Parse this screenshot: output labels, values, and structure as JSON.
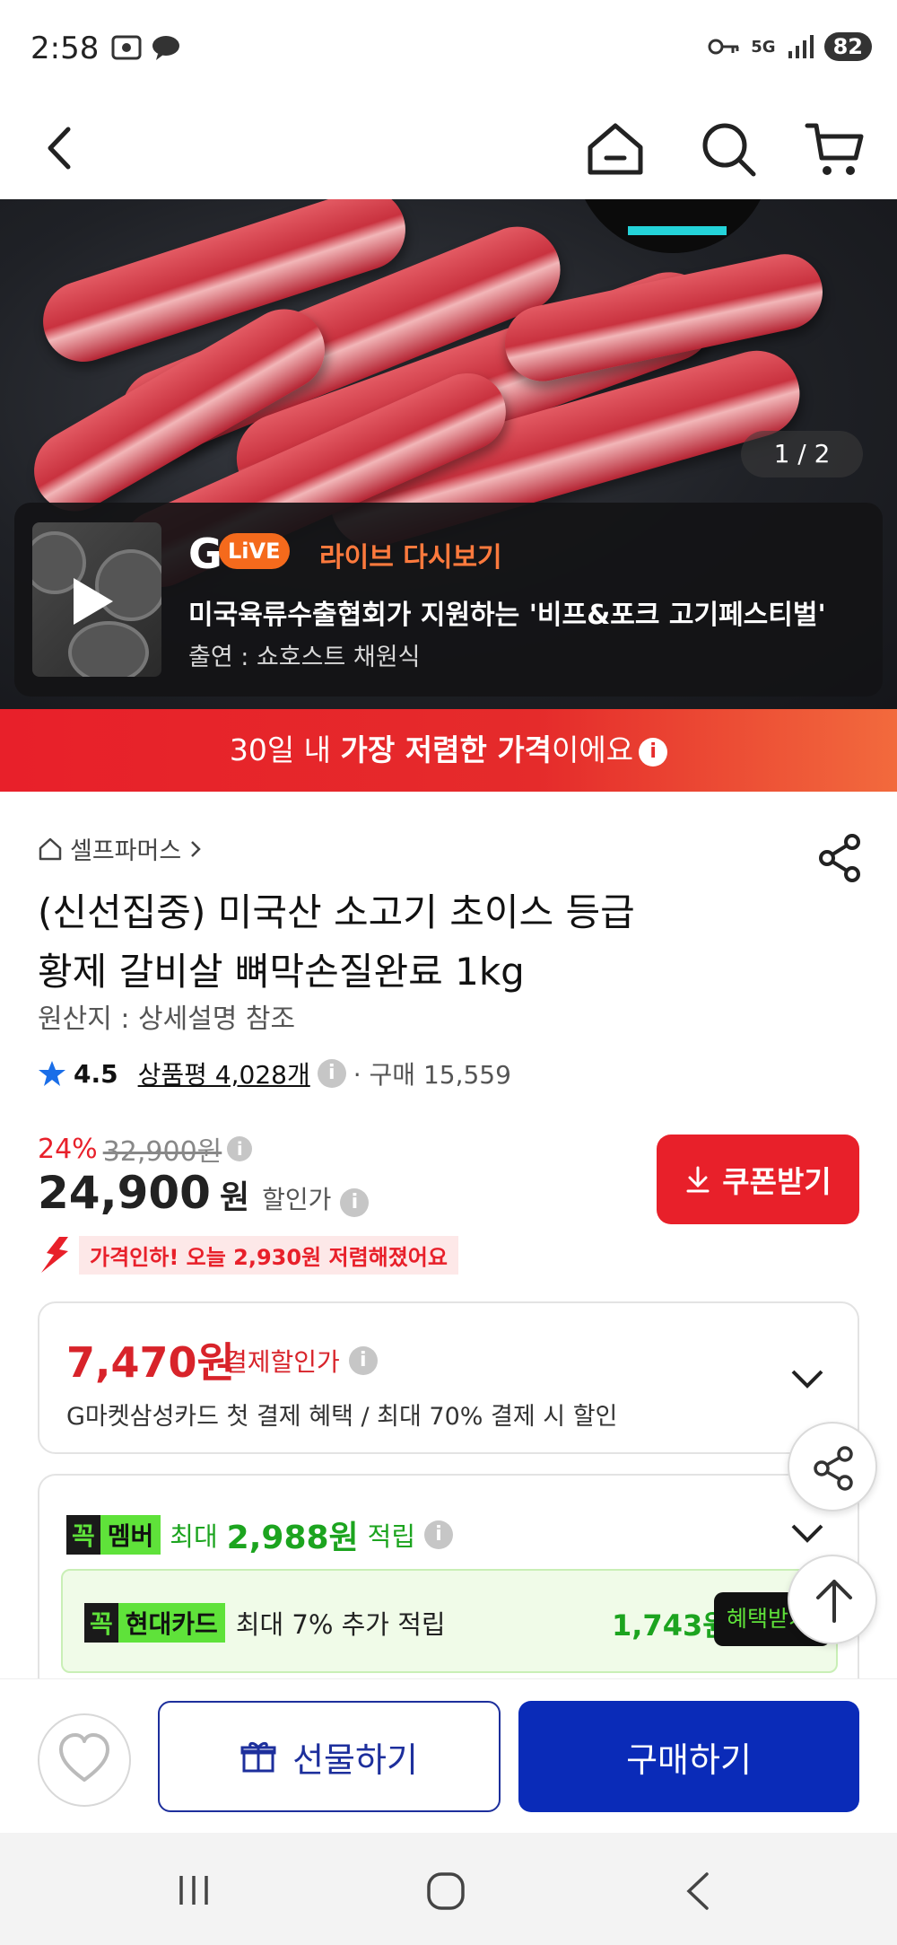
{
  "status_bar": {
    "time": "2:58",
    "network": "5G",
    "battery": "82"
  },
  "hero": {
    "image_counter": "1 / 2",
    "live": {
      "logo_g": "G",
      "logo_live": "LiVE",
      "label": "라이브 다시보기",
      "title": "미국육류수출협회가 지원하는 '비프&포크 고기페스티벌'",
      "host": "출연 : 쇼호스트 채원식"
    }
  },
  "price_banner": {
    "prefix": "30일 내 ",
    "highlight": "가장 저렴한 가격",
    "suffix": "이에요"
  },
  "product": {
    "seller": "셀프파머스",
    "title_line1": "(신선집중) 미국산 소고기 초이스 등급",
    "title_line2": "황제 갈비살 뼈막손질완료 1kg",
    "origin": "원산지 : 상세설명 참조",
    "rating": "4.5",
    "review_label": "상품평 4,028개",
    "purchase_label": "· 구매 15,559"
  },
  "pricing": {
    "discount_rate": "24%",
    "original_price": "32,900원",
    "sale_price": "24,900",
    "sale_unit": "원",
    "sale_label": "할인가",
    "coupon_button": "쿠폰받기",
    "price_drop": "가격인하! 오늘 2,930원 저렴해졌어요"
  },
  "payment_card": {
    "price": "7,470원",
    "label": "결제할인가",
    "desc": "G마켓삼성카드 첫 결제 혜택 / 최대 70% 결제 시 할인"
  },
  "member_card": {
    "tag_k": "꼭",
    "tag_member": "멤버",
    "prefix": "최대",
    "amount": "2,988원",
    "suffix": "적립",
    "hyundai_tag": "현대카드",
    "hyundai_desc": "최대 7% 추가 적립",
    "hyundai_amount": "1,743원",
    "benefit_button": "혜택받기"
  },
  "action_bar": {
    "gift_button": "선물하기",
    "buy_button": "구매하기"
  },
  "colors": {
    "accent_red": "#e8202a",
    "brand_blue": "#0a2bb8",
    "member_green": "#1ca41f",
    "live_orange": "#ff7a3d"
  }
}
